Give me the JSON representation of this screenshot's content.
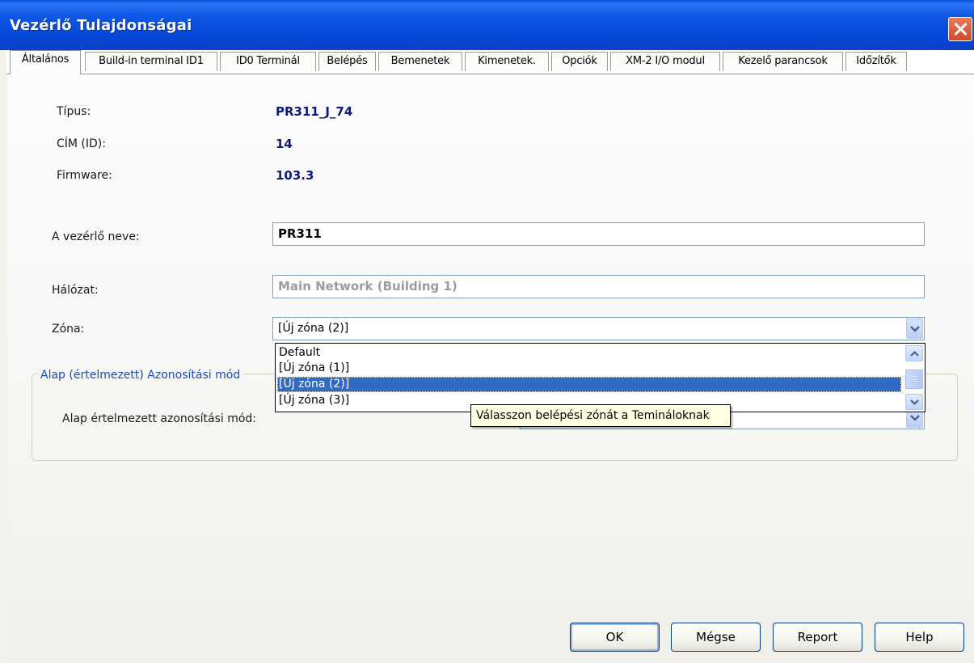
{
  "window": {
    "title": "Vezérlő Tulajdonságai"
  },
  "tabs": [
    {
      "label": "Általános",
      "active": true
    },
    {
      "label": "Build-in terminal ID1"
    },
    {
      "label": "ID0 Terminál"
    },
    {
      "label": "Belépés"
    },
    {
      "label": "Bemenetek"
    },
    {
      "label": "Kimenetek."
    },
    {
      "label": "Opciók"
    },
    {
      "label": "XM-2 I/O modul"
    },
    {
      "label": "Kezelő parancsok"
    },
    {
      "label": "Időzítők"
    }
  ],
  "info": {
    "type_label": "Típus:",
    "type_value": "PR311_J_74",
    "address_label": "CÍM (ID):",
    "address_value": "14",
    "firmware_label": "Firmware:",
    "firmware_value": "103.3"
  },
  "form": {
    "name_label": "A vezérlő neve:",
    "name_value": "PR311",
    "network_label": "Hálózat:",
    "network_value": "Main Network (Building 1)",
    "zone_label": "Zóna:",
    "zone_value": "[Új zóna (2)]",
    "zone_options": [
      "Default",
      "[Új zóna (1)]",
      "[Új zóna (2)]",
      "[Új zóna (3)]"
    ],
    "zone_selected_index": 2
  },
  "group": {
    "title": "Alap (értelmezett) Azonosítási mód",
    "id_mode_label": "Alap értelmezett azonosítási mód:"
  },
  "tooltip": "Válasszon belépési zónát a Temináloknak",
  "buttons": {
    "ok": "OK",
    "cancel": "Mégse",
    "report": "Report",
    "help": "Help"
  },
  "colors": {
    "titlebar": "#0a4fd9",
    "value_text": "#0e1a7a",
    "group_title": "#1a49c4",
    "selection": "#316ac5",
    "tooltip_bg": "#ffffe1"
  }
}
